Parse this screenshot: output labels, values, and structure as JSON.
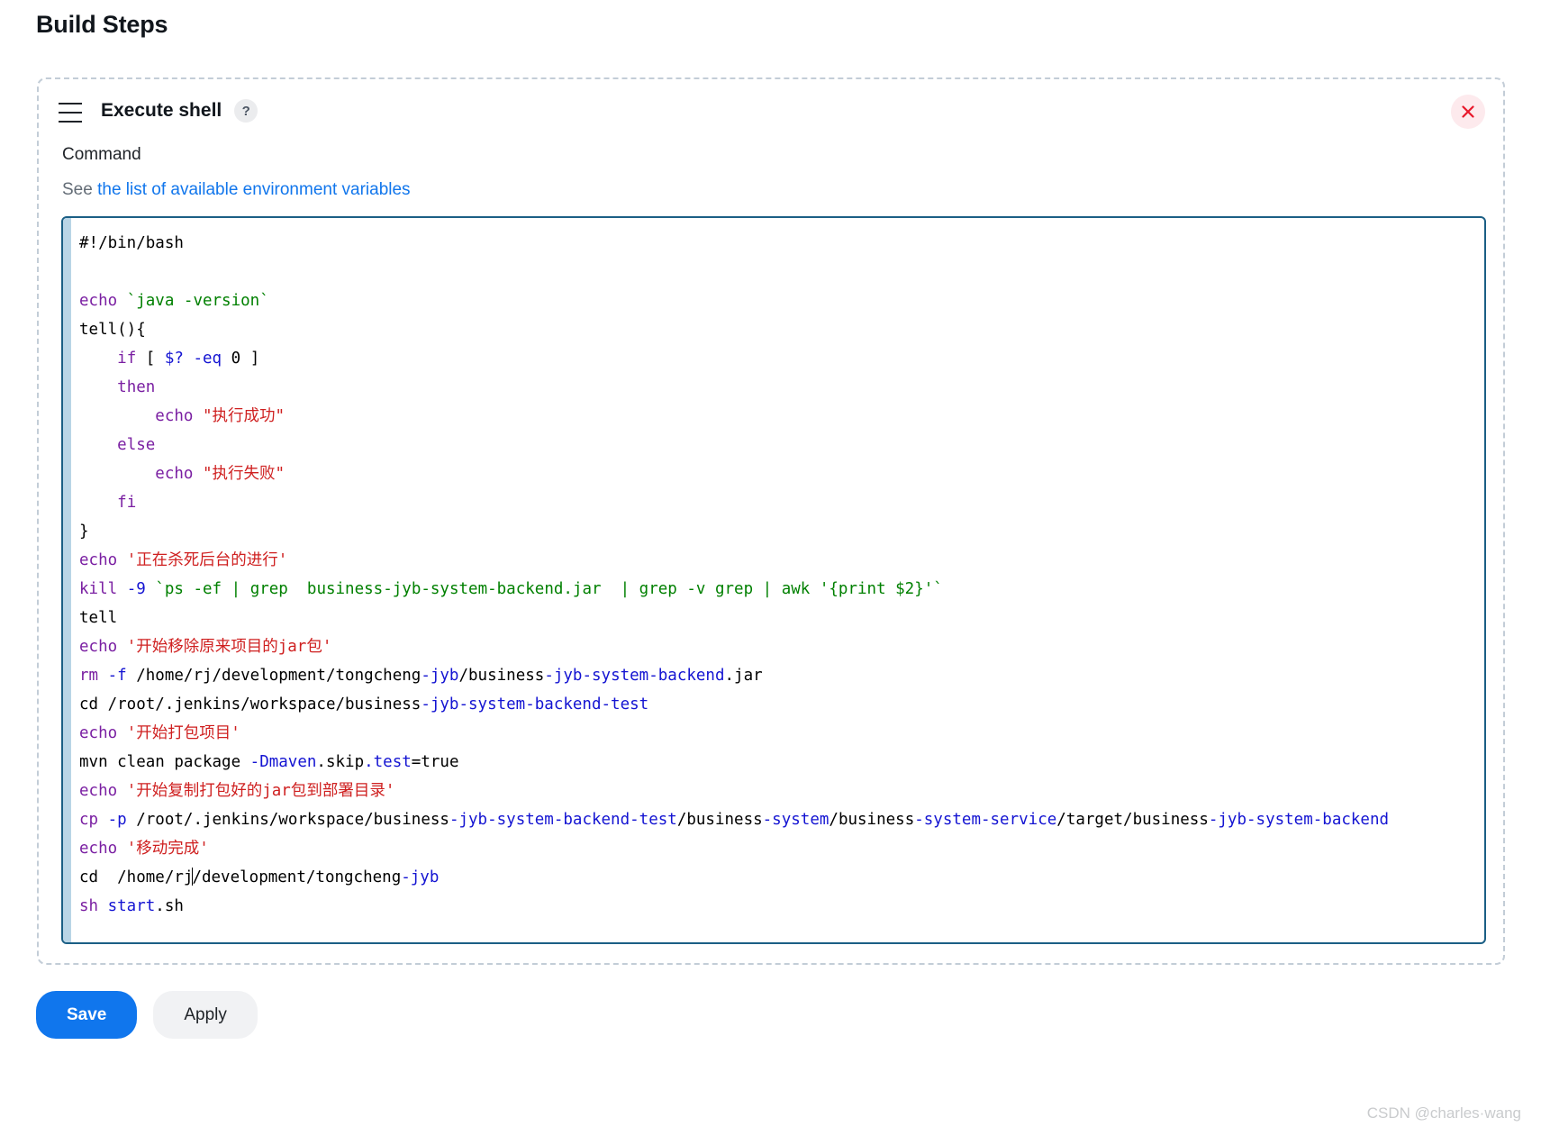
{
  "page_title": "Build Steps",
  "step": {
    "title": "Execute shell",
    "help_badge": "?",
    "drag_handle_icon": "hamburger-drag-icon",
    "close_icon": "close-x-icon",
    "close_icon_color": "#e8192c",
    "close_bg_color": "#fdeaed"
  },
  "command": {
    "label": "Command",
    "env_prefix": "See",
    "env_link": "the list of available environment variables",
    "link_color": "#1176ec"
  },
  "editor": {
    "border_color": "#1b5f85",
    "gutter_color": "#b9d5e6",
    "lines": [
      [
        {
          "t": "#!/bin/bash",
          "c": "plain"
        }
      ],
      [
        {
          "t": "",
          "c": "plain"
        }
      ],
      [
        {
          "t": "echo ",
          "c": "kw"
        },
        {
          "t": "`java -version`",
          "c": "str"
        }
      ],
      [
        {
          "t": "tell(){",
          "c": "plain"
        }
      ],
      [
        {
          "t": "    ",
          "c": "plain"
        },
        {
          "t": "if",
          "c": "kw"
        },
        {
          "t": " [ ",
          "c": "plain"
        },
        {
          "t": "$?",
          "c": "blue"
        },
        {
          "t": " ",
          "c": "plain"
        },
        {
          "t": "-eq",
          "c": "blue"
        },
        {
          "t": " ",
          "c": "plain"
        },
        {
          "t": "0",
          "c": "plain"
        },
        {
          "t": " ]",
          "c": "plain"
        }
      ],
      [
        {
          "t": "    ",
          "c": "plain"
        },
        {
          "t": "then",
          "c": "kw"
        }
      ],
      [
        {
          "t": "        ",
          "c": "plain"
        },
        {
          "t": "echo ",
          "c": "kw"
        },
        {
          "t": "\"执行成功\"",
          "c": "red"
        }
      ],
      [
        {
          "t": "    ",
          "c": "plain"
        },
        {
          "t": "else",
          "c": "kw"
        }
      ],
      [
        {
          "t": "        ",
          "c": "plain"
        },
        {
          "t": "echo ",
          "c": "kw"
        },
        {
          "t": "\"执行失败\"",
          "c": "red"
        }
      ],
      [
        {
          "t": "    ",
          "c": "plain"
        },
        {
          "t": "fi",
          "c": "kw"
        }
      ],
      [
        {
          "t": "}",
          "c": "plain"
        }
      ],
      [
        {
          "t": "echo ",
          "c": "kw"
        },
        {
          "t": "'正在杀死后台的进行'",
          "c": "red"
        }
      ],
      [
        {
          "t": "kill",
          "c": "kw"
        },
        {
          "t": " ",
          "c": "plain"
        },
        {
          "t": "-9",
          "c": "blue"
        },
        {
          "t": " ",
          "c": "plain"
        },
        {
          "t": "`ps ",
          "c": "str"
        },
        {
          "t": "-ef",
          "c": "str"
        },
        {
          "t": " | ",
          "c": "str"
        },
        {
          "t": "grep  business-jyb-system-backend.jar  | grep -v grep | awk '{print $2}'`",
          "c": "str"
        }
      ],
      [
        {
          "t": "tell",
          "c": "plain"
        }
      ],
      [
        {
          "t": "echo ",
          "c": "kw"
        },
        {
          "t": "'开始移除原来项目的jar包'",
          "c": "red"
        }
      ],
      [
        {
          "t": "rm",
          "c": "kw"
        },
        {
          "t": " ",
          "c": "plain"
        },
        {
          "t": "-f",
          "c": "blue"
        },
        {
          "t": " /home/rj/development/tongcheng",
          "c": "plain"
        },
        {
          "t": "-jyb",
          "c": "blue"
        },
        {
          "t": "/business",
          "c": "plain"
        },
        {
          "t": "-jyb-system-backend",
          "c": "blue"
        },
        {
          "t": ".jar",
          "c": "plain"
        }
      ],
      [
        {
          "t": "cd",
          "c": "plain"
        },
        {
          "t": " /root/.jenkins/workspace/business",
          "c": "plain"
        },
        {
          "t": "-jyb-system-backend-test",
          "c": "blue"
        }
      ],
      [
        {
          "t": "echo ",
          "c": "kw"
        },
        {
          "t": "'开始打包项目'",
          "c": "red"
        }
      ],
      [
        {
          "t": "mvn clean package ",
          "c": "plain"
        },
        {
          "t": "-Dmaven",
          "c": "blue"
        },
        {
          "t": ".skip",
          "c": "plain"
        },
        {
          "t": ".test",
          "c": "blue"
        },
        {
          "t": "=true",
          "c": "plain"
        }
      ],
      [
        {
          "t": "echo ",
          "c": "kw"
        },
        {
          "t": "'开始复制打包好的jar包到部署目录'",
          "c": "red"
        }
      ],
      [
        {
          "t": "cp",
          "c": "kw"
        },
        {
          "t": " ",
          "c": "plain"
        },
        {
          "t": "-p",
          "c": "blue"
        },
        {
          "t": " /root/.jenkins/workspace/business",
          "c": "plain"
        },
        {
          "t": "-jyb-system-backend-test",
          "c": "blue"
        },
        {
          "t": "/business",
          "c": "plain"
        },
        {
          "t": "-system",
          "c": "blue"
        },
        {
          "t": "/business",
          "c": "plain"
        },
        {
          "t": "-system-service",
          "c": "blue"
        },
        {
          "t": "/target/business",
          "c": "plain"
        },
        {
          "t": "-jyb-system-backend",
          "c": "blue"
        }
      ],
      [
        {
          "t": "echo ",
          "c": "kw"
        },
        {
          "t": "'移动完成'",
          "c": "red"
        }
      ],
      [
        {
          "t": "cd",
          "c": "plain"
        },
        {
          "t": "  /home/rj",
          "c": "plain"
        },
        {
          "t": "|CARET|",
          "c": "caret"
        },
        {
          "t": "/development/tongcheng",
          "c": "plain"
        },
        {
          "t": "-jyb",
          "c": "blue"
        }
      ],
      [
        {
          "t": "sh ",
          "c": "kw"
        },
        {
          "t": "start",
          "c": "blue"
        },
        {
          "t": ".sh",
          "c": "plain"
        }
      ]
    ]
  },
  "footer": {
    "save_label": "Save",
    "apply_label": "Apply",
    "save_color": "#1076ed",
    "apply_color": "#f1f2f4"
  },
  "watermark": "CSDN @charles·wang"
}
